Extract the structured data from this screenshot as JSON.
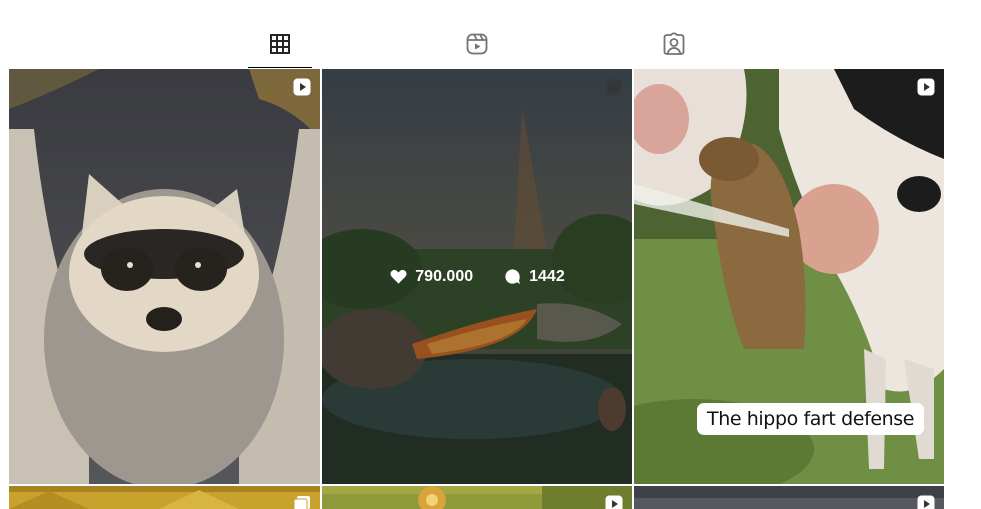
{
  "tabs": [
    {
      "name": "posts",
      "icon": "grid-icon",
      "active": true
    },
    {
      "name": "reels",
      "icon": "reels-icon",
      "active": false
    },
    {
      "name": "tagged",
      "icon": "tagged-user-icon",
      "active": false
    }
  ],
  "grid": {
    "tiles": [
      {
        "subject": "raccoon painting",
        "badge": "reel-icon"
      },
      {
        "subject": "hippo fire painting",
        "badge": "carousel-icon",
        "hover": {
          "likes": "790.000",
          "comments": "1442"
        }
      },
      {
        "subject": "capybara and cows painting",
        "badge": "reel-icon",
        "caption": "The hippo fart defense"
      },
      {
        "subject": "yellow field painting",
        "badge": "carousel-icon"
      },
      {
        "subject": "green burst painting",
        "badge": "reel-icon"
      },
      {
        "subject": "dark painting",
        "badge": "reel-icon"
      }
    ]
  },
  "colors": {
    "tab_icon_active": "#262626",
    "tab_icon_inactive": "#737373",
    "overlay_text": "#ffffff"
  }
}
